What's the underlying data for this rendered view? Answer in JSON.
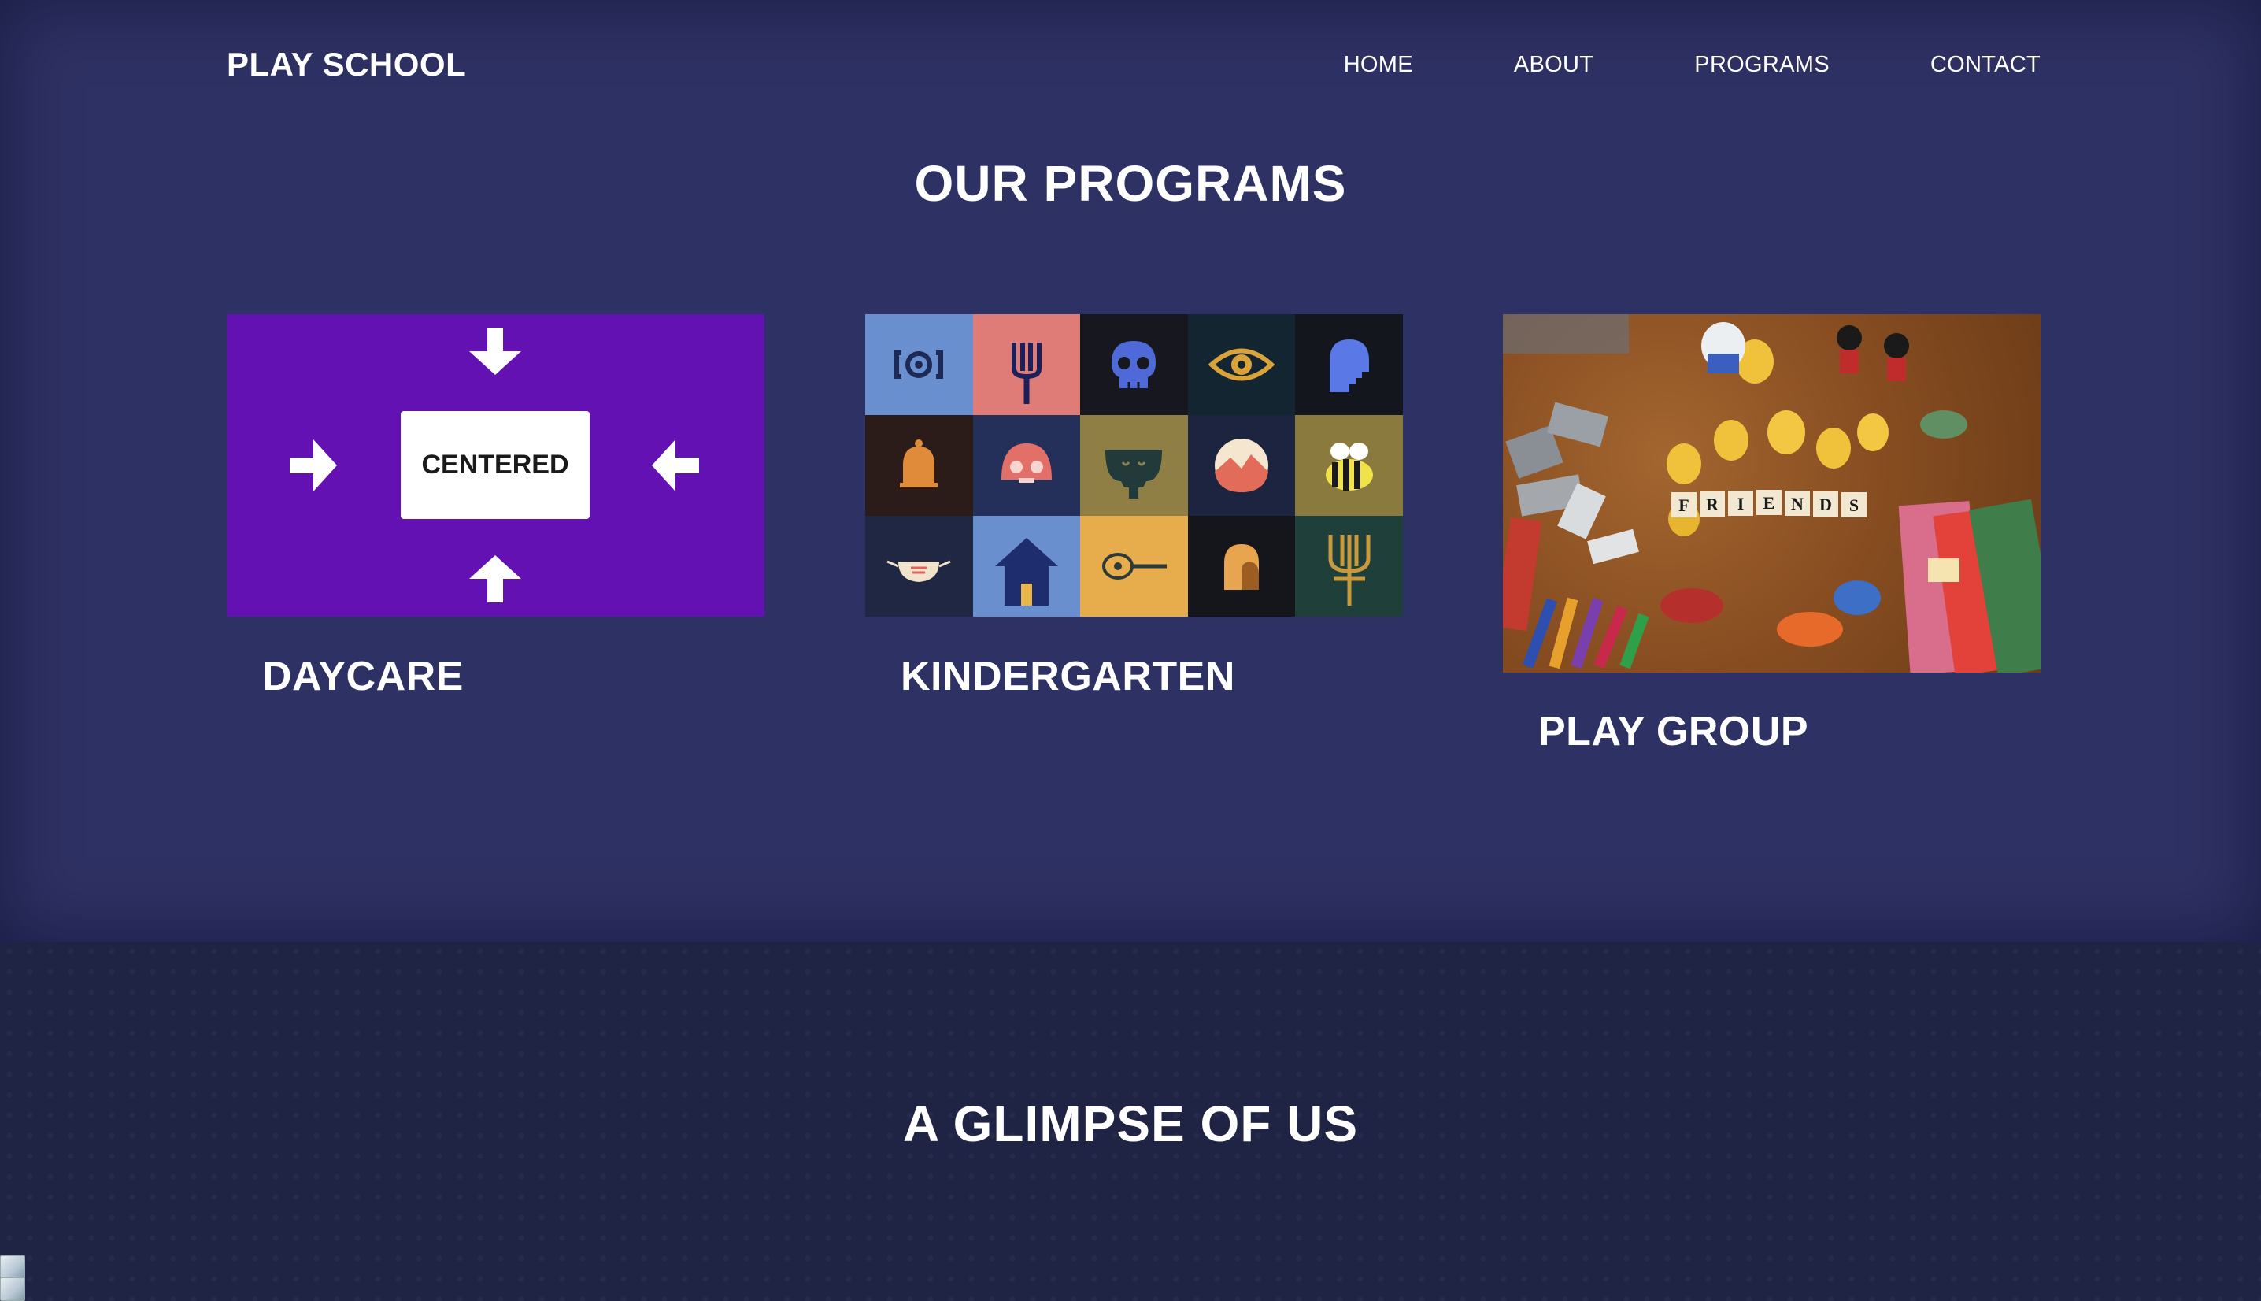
{
  "navbar": {
    "brand": "PLAY SCHOOL",
    "links": [
      "HOME",
      "ABOUT",
      "PROGRAMS",
      "CONTACT"
    ]
  },
  "programs": {
    "title": "OUR PROGRAMS",
    "cards": [
      {
        "title": "DAYCARE",
        "image_label": "CENTERED"
      },
      {
        "title": "KINDERGARTEN"
      },
      {
        "title": "PLAY GROUP",
        "image_label": "FRIENDS"
      }
    ]
  },
  "glimpse": {
    "title": "A GLIMPSE OF US"
  },
  "colors": {
    "top_background": "#2e3163",
    "bottom_background": "#1f2344",
    "daycare_purple": "#6411b4"
  }
}
